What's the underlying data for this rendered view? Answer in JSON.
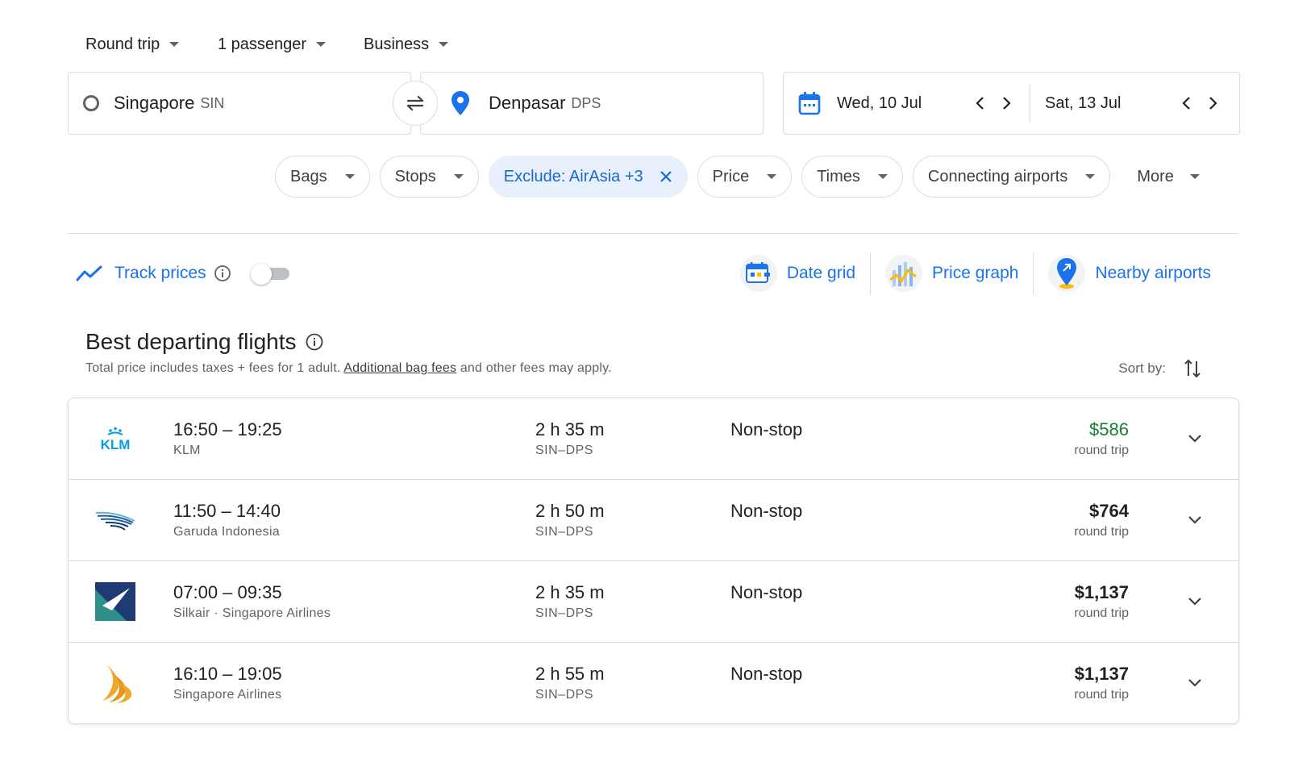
{
  "top_selectors": {
    "trip_type": "Round trip",
    "passengers": "1 passenger",
    "cabin": "Business"
  },
  "search": {
    "origin_city": "Singapore",
    "origin_code": "SIN",
    "destination_city": "Denpasar",
    "destination_code": "DPS",
    "depart_date": "Wed, 10 Jul",
    "return_date": "Sat, 13 Jul"
  },
  "filters": [
    {
      "label": "Bags"
    },
    {
      "label": "Stops"
    },
    {
      "label": "Exclude: AirAsia +3"
    },
    {
      "label": "Price"
    },
    {
      "label": "Times"
    },
    {
      "label": "Connecting airports"
    },
    {
      "label": "More"
    }
  ],
  "track_prices": {
    "label": "Track prices",
    "enabled": false
  },
  "tools": {
    "date_grid": "Date grid",
    "price_graph": "Price graph",
    "nearby_airports": "Nearby airports"
  },
  "section": {
    "title": "Best departing flights",
    "note_prefix": "Total price includes taxes + fees for 1 adult.",
    "note_link": "Additional bag fees",
    "note_suffix": "and other fees may apply.",
    "sort_label": "Sort by:"
  },
  "flights": [
    {
      "times": "16:50 – 19:25",
      "airline": "KLM",
      "duration": "2 h 35 m",
      "route": "SIN–DPS",
      "stops": "Non-stop",
      "price": "$586",
      "price_note": "round trip",
      "logo_icon": "klm-logo-icon",
      "logo_text": "KLM"
    },
    {
      "times": "11:50 – 14:40",
      "airline": "Garuda Indonesia",
      "duration": "2 h 50 m",
      "route": "SIN–DPS",
      "stops": "Non-stop",
      "price": "$764",
      "price_note": "round trip",
      "logo_icon": "garuda-logo-icon"
    },
    {
      "times": "07:00 – 09:35",
      "airline": "Silkair · Singapore Airlines",
      "duration": "2 h 35 m",
      "route": "SIN–DPS",
      "stops": "Non-stop",
      "price": "$1,137",
      "price_note": "round trip",
      "logo_icon": "silkair-logo-icon"
    },
    {
      "times": "16:10 – 19:05",
      "airline": "Singapore Airlines",
      "duration": "2 h 55 m",
      "route": "SIN–DPS",
      "stops": "Non-stop",
      "price": "$1,137",
      "price_note": "round trip",
      "logo_icon": "singapore-airlines-logo-icon"
    }
  ],
  "colors": {
    "accent": "#1a73e8",
    "chip_active_bg": "#e8f0fe",
    "best_price": "#188038"
  }
}
